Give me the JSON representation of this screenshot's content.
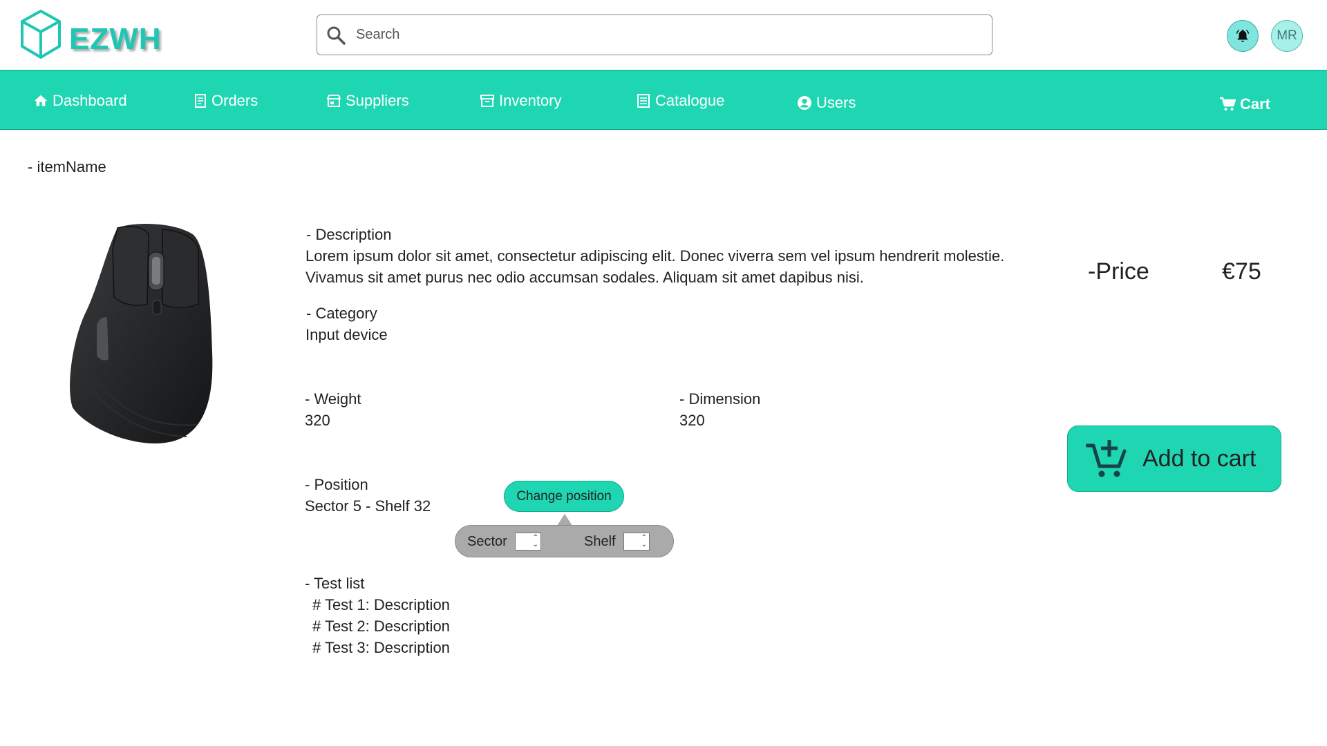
{
  "header": {
    "brand": "EZWH",
    "search_placeholder": "Search",
    "avatar_initials": "MR"
  },
  "nav": {
    "items": [
      {
        "label": "Dashboard",
        "icon": "home-icon"
      },
      {
        "label": "Orders",
        "icon": "receipt-icon"
      },
      {
        "label": "Suppliers",
        "icon": "store-icon"
      },
      {
        "label": "Inventory",
        "icon": "archive-icon"
      },
      {
        "label": "Catalogue",
        "icon": "list-icon"
      },
      {
        "label": "Users",
        "icon": "user-circle-icon"
      }
    ],
    "cart": {
      "label": "Cart",
      "icon": "cart-icon"
    }
  },
  "item": {
    "name": "- itemName",
    "description_label": "- Description",
    "description_line1": "Lorem ipsum dolor sit amet, consectetur adipiscing elit. Donec viverra sem vel ipsum hendrerit molestie.",
    "description_line2": "Vivamus sit amet purus nec odio accumsan sodales. Aliquam sit amet dapibus nisi.",
    "category_label": "- Category",
    "category_value": "Input device",
    "weight_label": "- Weight",
    "weight_value": "320",
    "dimension_label": "- Dimension",
    "dimension_value": "320",
    "position_label": "- Position",
    "position_value": "Sector 5 - Shelf 32",
    "test_list_label": "- Test list",
    "tests": [
      "# Test 1: Description",
      "# Test 2: Description",
      "# Test 3: Description"
    ]
  },
  "price": {
    "label": "-Price",
    "value": "€75"
  },
  "actions": {
    "add_to_cart": "Add to cart",
    "change_position": "Change position",
    "sector_label": "Sector",
    "shelf_label": "Shelf"
  },
  "colors": {
    "accent": "#1fd6b3",
    "brand": "#1ec6b4",
    "panel_gray": "#aaaaaa"
  }
}
